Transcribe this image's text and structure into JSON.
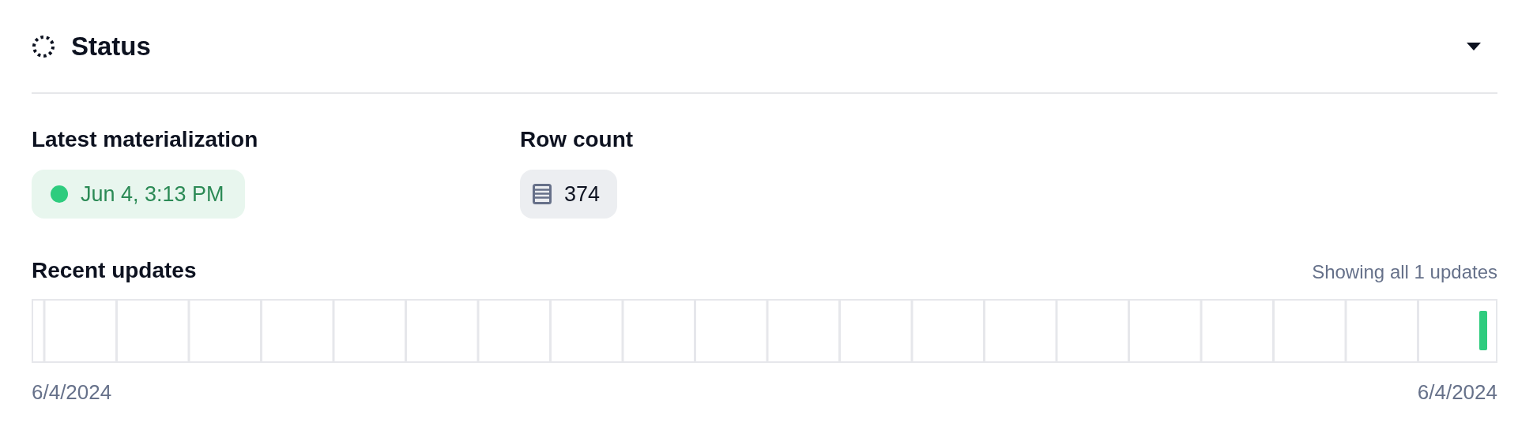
{
  "section": {
    "title": "Status",
    "expanded": true
  },
  "metrics": [
    {
      "kind": "timestamp",
      "label": "Latest materialization",
      "value": "Jun 4, 3:13 PM",
      "succeeded": true
    },
    {
      "kind": "rows",
      "label": "Row count",
      "value": "374"
    }
  ],
  "recent_updates": {
    "title": "Recent updates",
    "summary": "Showing all 1 updates",
    "start_label": "6/4/2024",
    "end_label": "6/4/2024"
  }
}
